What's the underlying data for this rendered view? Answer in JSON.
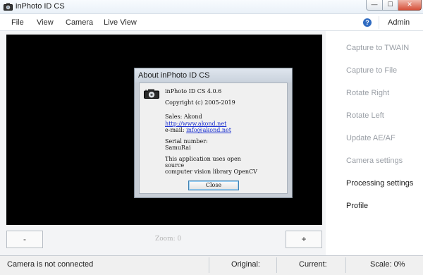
{
  "window": {
    "title": "inPhoto ID CS",
    "controls": {
      "minimize": "—",
      "maximize": "☐",
      "close": "✕"
    }
  },
  "menu": {
    "items": [
      "File",
      "View",
      "Camera",
      "Live View"
    ],
    "help": "?",
    "user": "Admin"
  },
  "sidebar": {
    "items": [
      {
        "label": "Capture to TWAIN",
        "enabled": false
      },
      {
        "label": "Capture to File",
        "enabled": false
      },
      {
        "label": "Rotate Right",
        "enabled": false
      },
      {
        "label": "Rotate Left",
        "enabled": false
      },
      {
        "label": "Update AE/AF",
        "enabled": false
      },
      {
        "label": "Camera settings",
        "enabled": false
      },
      {
        "label": "Processing settings",
        "enabled": true
      },
      {
        "label": "Profile",
        "enabled": true
      }
    ]
  },
  "zoom": {
    "minus": "-",
    "plus": "+",
    "label": "Zoom: 0"
  },
  "status": {
    "connection": "Camera is not connected",
    "original": "Original:",
    "current": "Current:",
    "scale": "Scale: 0%"
  },
  "about": {
    "title": "About inPhoto ID CS",
    "product": "inPhoto ID CS 4.0.6",
    "copyright": "Copyright (c) 2005-2019",
    "sales_label": "Sales: Akond",
    "website": "http://www.akond.net",
    "email_label": "e-mail: ",
    "email": "info@akond.net",
    "serial_label": "Serial number:",
    "serial_value": "SamuRai",
    "opencv_line1": "This application uses open",
    "opencv_line2": "source",
    "opencv_line3": "computer vision library OpenCV",
    "close_label": "Close"
  },
  "colors": {
    "accent": "#2f6bc1",
    "link": "#1a2fd0",
    "preview_background": "#000000",
    "disabled_text": "#9a9fa6"
  },
  "icons": {
    "app": "camera-icon",
    "dialog": "camera-icon",
    "help": "help-icon"
  }
}
